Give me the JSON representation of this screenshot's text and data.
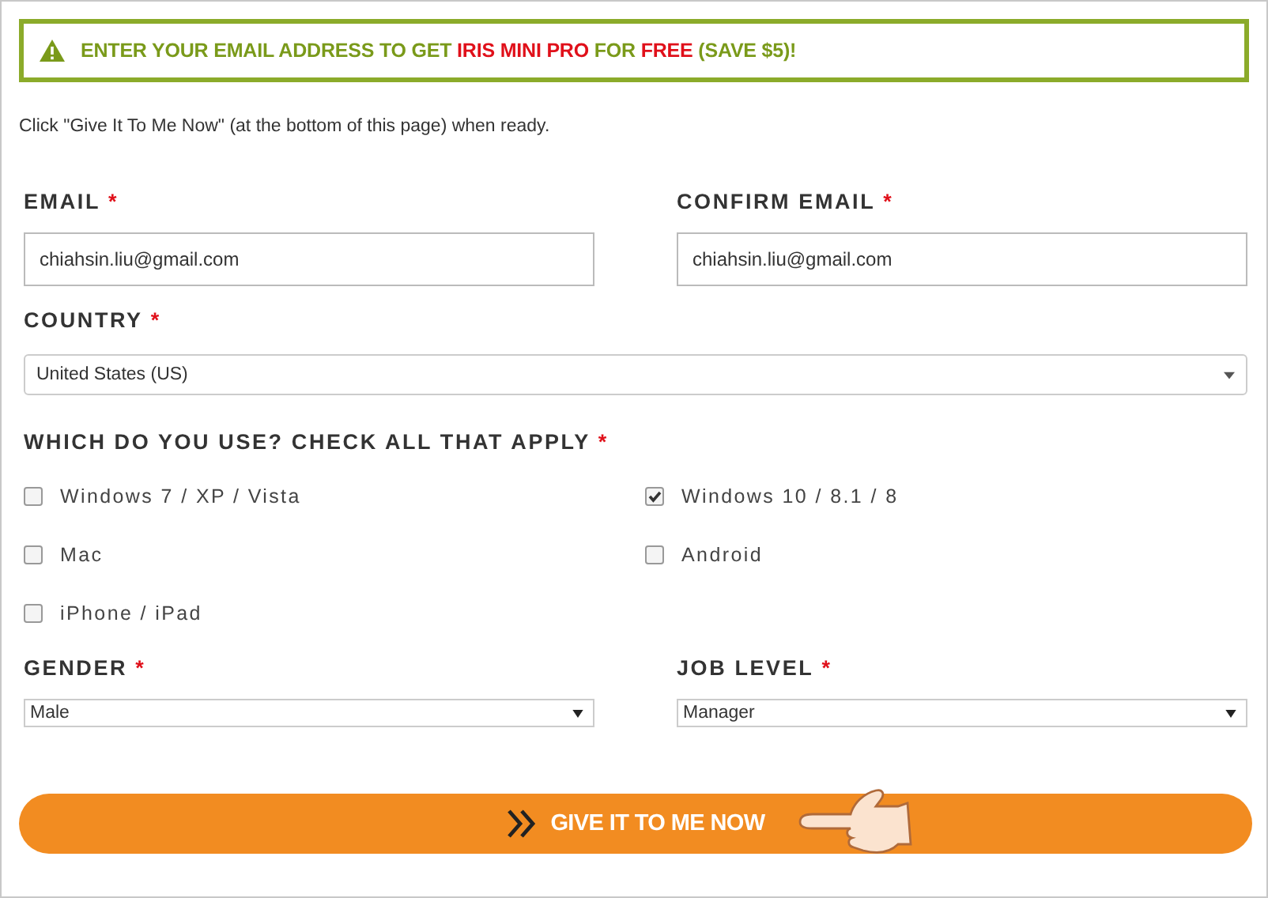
{
  "banner": {
    "segments": [
      {
        "text": "ENTER YOUR EMAIL ADDRESS TO GET ",
        "kind": "normal"
      },
      {
        "text": "IRIS MINI PRO",
        "kind": "highlight"
      },
      {
        "text": " FOR ",
        "kind": "normal"
      },
      {
        "text": "FREE",
        "kind": "highlight"
      },
      {
        "text": " (SAVE $5)!",
        "kind": "normal"
      }
    ]
  },
  "intro": "Click \"Give It To Me Now\" (at the bottom of this page) when ready.",
  "email": {
    "label": "EMAIL",
    "mark": "*",
    "value": "chiahsin.liu@gmail.com"
  },
  "confirm_email": {
    "label": "CONFIRM EMAIL",
    "mark": "*",
    "value": "chiahsin.liu@gmail.com"
  },
  "country": {
    "label": "COUNTRY",
    "mark": "*",
    "value": "United States (US)"
  },
  "platforms": {
    "label": "WHICH DO YOU USE? CHECK ALL THAT APPLY",
    "mark": "*",
    "options": [
      {
        "label": "Windows 7 / XP / Vista",
        "checked": false
      },
      {
        "label": "Windows 10 / 8.1 / 8",
        "checked": true
      },
      {
        "label": "Mac",
        "checked": false
      },
      {
        "label": "Android",
        "checked": false
      },
      {
        "label": "iPhone / iPad",
        "checked": false
      }
    ]
  },
  "gender": {
    "label": "GENDER",
    "mark": "*",
    "value": "Male"
  },
  "job_level": {
    "label": "JOB LEVEL",
    "mark": "*",
    "value": "Manager"
  },
  "submit": {
    "label": "GIVE IT TO ME NOW"
  }
}
